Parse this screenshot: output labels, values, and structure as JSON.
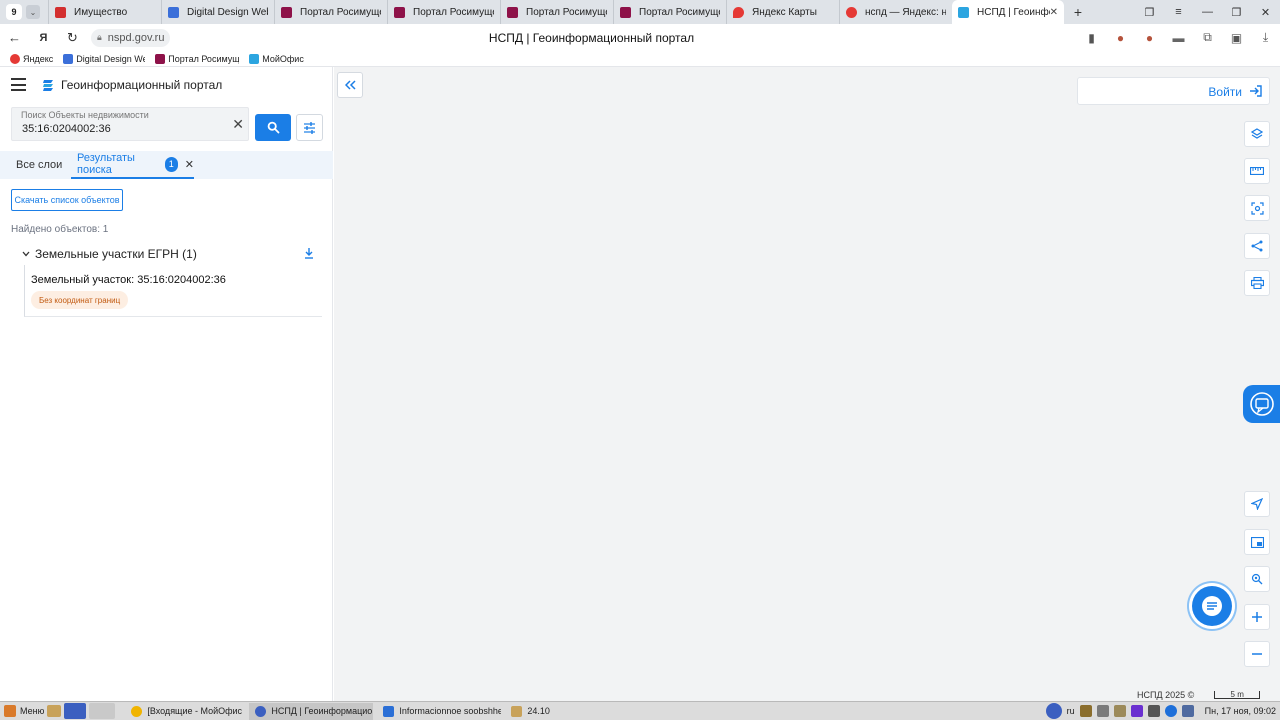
{
  "browser": {
    "tab_count": "9",
    "tabs": [
      {
        "title": "Имущество",
        "color": "#d32f2f"
      },
      {
        "title": "Digital Design Web C",
        "color": "#3b6fd9"
      },
      {
        "title": "Портал Росимущест",
        "color": "#8e1249"
      },
      {
        "title": "Портал Росимущест",
        "color": "#8e1249"
      },
      {
        "title": "Портал Росимущест",
        "color": "#8e1249"
      },
      {
        "title": "Портал Росимущест",
        "color": "#8e1249"
      },
      {
        "title": "Яндекс Карты",
        "color": "#e53935"
      },
      {
        "title": "нспд — Яндекс: наш",
        "color": "#e53935"
      }
    ],
    "active_tab": {
      "title": "НСПД | Геоинфор",
      "color": "#2ca5e0"
    },
    "url": "nspd.gov.ru",
    "page_title": "НСПД | Геоинформационный портал",
    "bookmarks": [
      {
        "label": "Яндекс",
        "color": "#e53935"
      },
      {
        "label": "Digital Design We",
        "color": "#3b6fd9"
      },
      {
        "label": "Портал Росимущ",
        "color": "#8e1249"
      },
      {
        "label": "МойОфис",
        "color": "#2ca5e0"
      }
    ]
  },
  "panel": {
    "title": "Геоинформационный портал",
    "search": {
      "label": "Поиск Объекты недвижимости",
      "value": "35:16:0204002:36"
    },
    "tabs": {
      "all_layers": "Все слои",
      "results": "Результаты поиска",
      "results_count": "1"
    },
    "download_list": "Скачать список объектов",
    "found": "Найдено объектов: 1",
    "group": {
      "title": "Земельные участки ЕГРН (1)",
      "item": {
        "title": "Земельный участок: 35:16:0204002:36",
        "tag": "Без координат границ"
      }
    }
  },
  "map": {
    "login": "Войти",
    "copyright": "НСПД 2025 ©",
    "scale": "5 m"
  },
  "taskbar": {
    "menu": "Меню",
    "tasks": [
      {
        "label": "[Входящие - МойОфис П...",
        "color": "#f0b400"
      },
      {
        "label": "НСПД | Геоинформацио...",
        "color": "#3b5fc0"
      },
      {
        "label": "Informacionnoe soobshhe...",
        "color": "#2b6fd6"
      },
      {
        "label": "24.10",
        "color": "#c8a25a"
      }
    ],
    "lang": "ru",
    "clock": "Пн, 17 ноя, 09:02"
  },
  "colors": {
    "accent": "#1b7ee6",
    "tag_bg": "#fdeee2",
    "tag_text": "#c25b12"
  }
}
